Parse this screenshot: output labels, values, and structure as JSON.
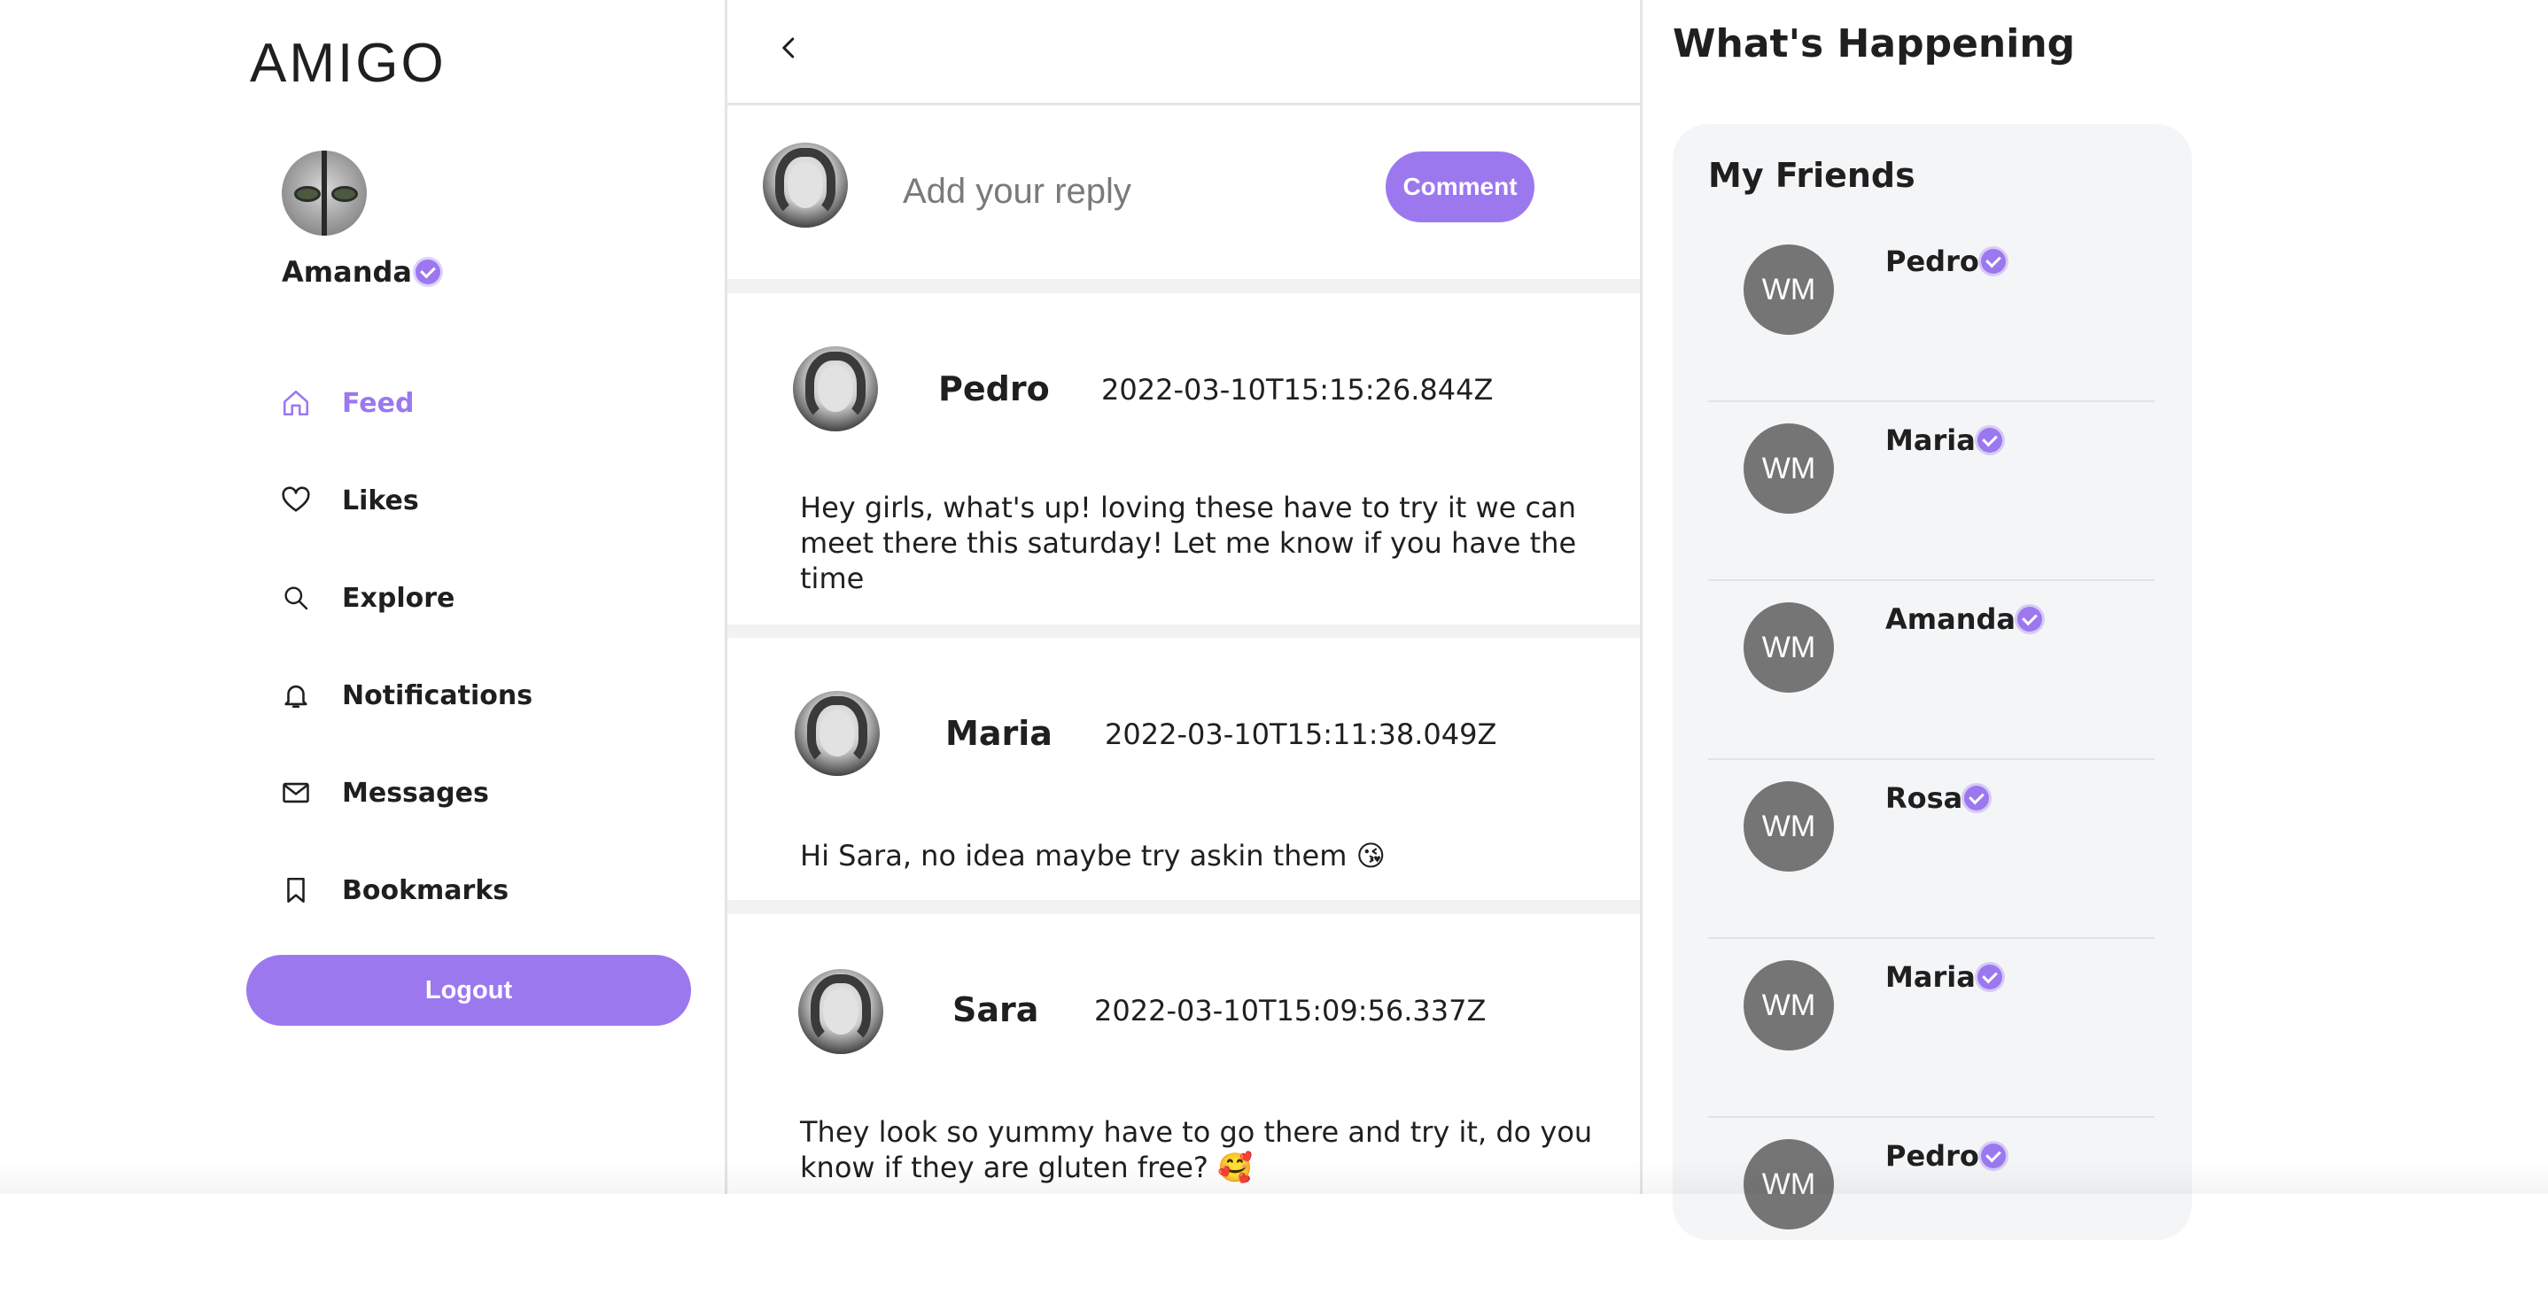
{
  "app": {
    "logo": "AMIGO"
  },
  "profile": {
    "name": "Amanda",
    "verified": true
  },
  "nav": {
    "items": [
      {
        "label": "Feed",
        "icon": "home-icon",
        "active": true
      },
      {
        "label": "Likes",
        "icon": "heart-icon",
        "active": false
      },
      {
        "label": "Explore",
        "icon": "search-icon",
        "active": false
      },
      {
        "label": "Notifications",
        "icon": "bell-icon",
        "active": false
      },
      {
        "label": "Messages",
        "icon": "mail-icon",
        "active": false
      },
      {
        "label": "Bookmarks",
        "icon": "bookmark-icon",
        "active": false
      }
    ],
    "logout_label": "Logout"
  },
  "reply": {
    "placeholder": "Add your reply",
    "comment_label": "Comment"
  },
  "comments": [
    {
      "author": "Pedro",
      "timestamp": "2022-03-10T15:15:26.844Z",
      "text": "Hey girls, what's up! loving these have to try it we can meet there this saturday! Let me know if you have the time"
    },
    {
      "author": "Maria",
      "timestamp": "2022-03-10T15:11:38.049Z",
      "text": "Hi Sara, no idea maybe try askin them 😘"
    },
    {
      "author": "Sara",
      "timestamp": "2022-03-10T15:09:56.337Z",
      "text": "They look so yummy have to go there and try it, do you know if they are gluten free? 🥰"
    }
  ],
  "sidebar_right": {
    "title": "What's Happening",
    "friends_title": "My Friends",
    "friends": [
      {
        "initials": "WM",
        "name": "Pedro"
      },
      {
        "initials": "WM",
        "name": "Maria"
      },
      {
        "initials": "WM",
        "name": "Amanda"
      },
      {
        "initials": "WM",
        "name": "Rosa"
      },
      {
        "initials": "WM",
        "name": "Maria"
      },
      {
        "initials": "WM",
        "name": "Pedro"
      }
    ]
  },
  "colors": {
    "accent": "#9c78ef",
    "text": "#1f1f1f",
    "card_bg": "#f4f5f7",
    "avatar_grey": "#757575"
  }
}
